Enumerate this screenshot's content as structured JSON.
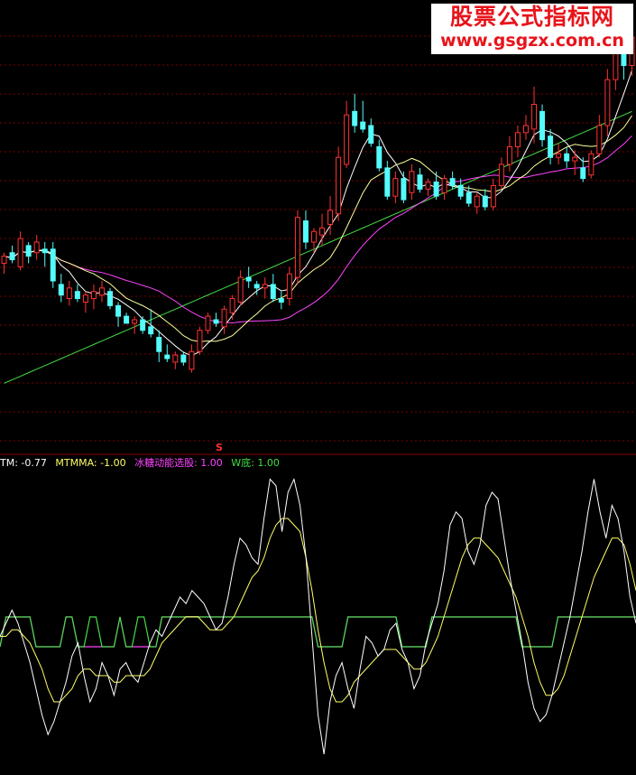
{
  "watermark": {
    "title": "股票公式指标网",
    "url": "www.gsgzx.com.cn"
  },
  "marker": {
    "symbol": "S"
  },
  "colors": {
    "background": "#000000",
    "up": "#ff3232",
    "down": "#54fcfc",
    "ma5": "#ffffff",
    "ma10": "#ffff99",
    "ma20": "#ff44ff",
    "ma60": "#44dd44",
    "grid": "#7a0000",
    "separator": "#8a0000"
  },
  "legend": [
    {
      "label": "TM",
      "value": "-0.77",
      "color": "#ffffff"
    },
    {
      "label": "MTMMA",
      "value": "-1.00",
      "color": "#ffff66"
    },
    {
      "label": "冰糖动能选股",
      "value": "1.00",
      "color": "#ff44ff"
    },
    {
      "label": "W底",
      "value": "1.00",
      "color": "#44dd44"
    }
  ],
  "chart_data": [
    {
      "type": "candlestick",
      "ylim": [
        0,
        100
      ],
      "candles": [
        [
          58,
          61,
          55,
          60
        ],
        [
          61,
          63,
          58,
          59
        ],
        [
          57,
          67,
          56,
          65
        ],
        [
          63,
          64,
          58,
          60
        ],
        [
          61,
          66,
          59,
          64
        ],
        [
          62,
          64,
          57,
          61
        ],
        [
          62,
          64,
          51,
          53
        ],
        [
          52,
          55,
          47,
          49
        ],
        [
          48,
          53,
          46,
          51
        ],
        [
          50,
          52,
          47,
          48
        ],
        [
          47,
          50,
          44,
          49
        ],
        [
          48,
          52,
          45,
          50
        ],
        [
          49,
          53,
          47,
          51
        ],
        [
          50,
          51,
          45,
          46
        ],
        [
          46,
          47,
          40,
          43
        ],
        [
          43,
          44,
          41,
          41
        ],
        [
          41,
          43,
          38,
          42
        ],
        [
          42,
          43,
          38,
          39
        ],
        [
          40,
          45,
          37,
          38
        ],
        [
          37,
          39,
          30,
          33
        ],
        [
          32,
          35,
          30,
          31
        ],
        [
          30,
          33,
          28,
          32
        ],
        [
          32,
          33,
          29,
          30
        ],
        [
          28,
          35,
          27,
          33
        ],
        [
          33,
          40,
          32,
          39
        ],
        [
          39,
          44,
          38,
          43
        ],
        [
          42,
          44,
          40,
          41
        ],
        [
          40,
          46,
          38,
          45
        ],
        [
          44,
          49,
          42,
          48
        ],
        [
          47,
          56,
          46,
          54
        ],
        [
          54,
          57,
          51,
          53
        ],
        [
          52,
          53,
          49,
          51
        ],
        [
          51,
          54,
          48,
          52
        ],
        [
          52,
          55,
          47,
          48
        ],
        [
          48,
          50,
          45,
          47
        ],
        [
          48,
          57,
          46,
          55
        ],
        [
          54,
          73,
          52,
          71
        ],
        [
          70,
          73,
          62,
          64
        ],
        [
          64,
          68,
          61,
          67
        ],
        [
          66,
          72,
          63,
          68
        ],
        [
          69,
          77,
          66,
          73
        ],
        [
          72,
          91,
          70,
          88
        ],
        [
          86,
          104,
          85,
          100
        ],
        [
          101,
          106,
          95,
          97
        ],
        [
          98,
          104,
          95,
          96
        ],
        [
          97,
          99,
          91,
          92
        ],
        [
          91,
          93,
          84,
          85
        ],
        [
          85,
          87,
          76,
          77
        ],
        [
          77,
          84,
          75,
          82
        ],
        [
          82,
          84,
          75,
          76
        ],
        [
          78,
          86,
          76,
          84
        ],
        [
          83,
          85,
          78,
          79
        ],
        [
          79,
          82,
          77,
          81
        ],
        [
          81,
          84,
          76,
          77
        ],
        [
          78,
          83,
          76,
          82
        ],
        [
          82,
          84,
          79,
          80
        ],
        [
          80,
          82,
          76,
          77
        ],
        [
          78,
          80,
          74,
          75
        ],
        [
          74,
          78,
          72,
          77
        ],
        [
          77,
          79,
          73,
          74
        ],
        [
          74,
          82,
          73,
          80
        ],
        [
          80,
          88,
          79,
          86
        ],
        [
          86,
          94,
          84,
          91
        ],
        [
          91,
          97,
          88,
          95
        ],
        [
          95,
          100,
          93,
          97
        ],
        [
          96,
          108,
          92,
          103
        ],
        [
          101,
          103,
          91,
          93
        ],
        [
          94,
          96,
          86,
          88
        ],
        [
          88,
          92,
          86,
          89
        ],
        [
          89,
          91,
          85,
          87
        ],
        [
          87,
          90,
          83,
          88
        ],
        [
          85,
          88,
          81,
          82
        ],
        [
          83,
          90,
          82,
          89
        ],
        [
          89,
          100,
          88,
          97
        ],
        [
          97,
          113,
          94,
          110
        ],
        [
          110,
          124,
          107,
          120
        ],
        [
          119,
          122,
          110,
          114
        ],
        [
          114,
          126,
          111,
          122
        ]
      ],
      "ma60": [
        24,
        25,
        26,
        27,
        28,
        29,
        30,
        31,
        32,
        33,
        34,
        35,
        36,
        37,
        38,
        39,
        40,
        41,
        42,
        43,
        44,
        45,
        46,
        47,
        48,
        49,
        50,
        51,
        52,
        53,
        54,
        55,
        56,
        57,
        58,
        59,
        60,
        61,
        62,
        63,
        64,
        65,
        66,
        67,
        68,
        69,
        70,
        71,
        72,
        73,
        74,
        75,
        76,
        77,
        78,
        79,
        80,
        81,
        82,
        83,
        84,
        85,
        86,
        87,
        88,
        89,
        90,
        91,
        92,
        93,
        94,
        95,
        96,
        97,
        98,
        99,
        100,
        101
      ]
    },
    {
      "type": "line",
      "ylim": [
        -20,
        20
      ],
      "series": [
        {
          "name": "TM",
          "values": [
            -2,
            0,
            2,
            0,
            -3,
            -6,
            -10,
            -14,
            -17,
            -15,
            -12,
            -9,
            -5,
            -3,
            -8,
            -12,
            -10,
            -6,
            -8,
            -11,
            -7,
            -6,
            -8,
            -9,
            -6,
            -3,
            -1,
            -2,
            0,
            2,
            4,
            3,
            5,
            4,
            3,
            1,
            -1,
            0,
            4,
            9,
            13,
            12,
            10,
            9,
            16,
            22,
            21,
            14,
            20,
            22,
            18,
            10,
            -2,
            -14,
            -20,
            -12,
            -8,
            -6,
            -10,
            -13,
            -7,
            -2,
            -3,
            -5,
            -4,
            -1,
            0,
            -4,
            -6,
            -10,
            -8,
            -3,
            0,
            3,
            8,
            15,
            17,
            16,
            11,
            9,
            12,
            18,
            20,
            19,
            13,
            7,
            2,
            -3,
            -9,
            -13,
            -15,
            -14,
            -11,
            -7,
            -3,
            1,
            6,
            11,
            17,
            22,
            17,
            13,
            18,
            16,
            11,
            4,
            0
          ]
        },
        {
          "name": "MTMMA",
          "values": [
            -2,
            -2,
            -1,
            -1,
            -2,
            -3,
            -5,
            -7,
            -10,
            -12,
            -12,
            -11,
            -10,
            -8,
            -7,
            -7,
            -8,
            -8,
            -8,
            -9,
            -9,
            -8,
            -8,
            -8,
            -8,
            -7,
            -5,
            -3,
            -2,
            -1,
            0,
            1,
            1,
            1,
            0,
            -1,
            -1,
            -1,
            0,
            1,
            3,
            5,
            7,
            8,
            10,
            13,
            15,
            16,
            16,
            15,
            14,
            10,
            5,
            -1,
            -6,
            -10,
            -12,
            -12,
            -11,
            -9,
            -8,
            -7,
            -6,
            -5,
            -4,
            -4,
            -4,
            -5,
            -6,
            -7,
            -7,
            -6,
            -4,
            -2,
            1,
            4,
            7,
            10,
            12,
            13,
            13,
            12,
            11,
            10,
            8,
            6,
            4,
            1,
            -2,
            -6,
            -9,
            -11,
            -11,
            -10,
            -8,
            -5,
            -2,
            1,
            4,
            7,
            9,
            11,
            13,
            13,
            12,
            9,
            5
          ]
        },
        {
          "name": "冰糖动能选股",
          "values": [
            0,
            1,
            1,
            1,
            1,
            1,
            0,
            0,
            0,
            0,
            0,
            1,
            1,
            0,
            0,
            0,
            0,
            0,
            0,
            0,
            1,
            0,
            0,
            0,
            0,
            0,
            0,
            1,
            1,
            1,
            1,
            1,
            1,
            1,
            1,
            1,
            1,
            1,
            1,
            1,
            1,
            1,
            1,
            1,
            1,
            1,
            1,
            1,
            1,
            1,
            1,
            1,
            1,
            0,
            0,
            0,
            0,
            0,
            1,
            1,
            1,
            1,
            1,
            1,
            1,
            1,
            1,
            0,
            0,
            0,
            0,
            0,
            1,
            1,
            1,
            1,
            1,
            1,
            1,
            1,
            1,
            1,
            1,
            1,
            1,
            1,
            1,
            0,
            0,
            0,
            0,
            0,
            0,
            1,
            1,
            1,
            1,
            1,
            1,
            1,
            1,
            1,
            1,
            1,
            1,
            1,
            1
          ]
        },
        {
          "name": "W底",
          "values": [
            0,
            1,
            1,
            1,
            1,
            1,
            0,
            0,
            0,
            0,
            0,
            1,
            1,
            0,
            0,
            1,
            1,
            0,
            0,
            0,
            1,
            0,
            0,
            1,
            1,
            0,
            0,
            1,
            1,
            1,
            1,
            1,
            1,
            1,
            1,
            1,
            1,
            1,
            1,
            1,
            1,
            1,
            1,
            1,
            1,
            1,
            1,
            1,
            1,
            1,
            1,
            1,
            1,
            0,
            0,
            0,
            0,
            0,
            1,
            1,
            1,
            1,
            1,
            1,
            1,
            1,
            1,
            0,
            0,
            0,
            0,
            0,
            1,
            1,
            1,
            1,
            1,
            1,
            1,
            1,
            1,
            1,
            1,
            1,
            1,
            1,
            1,
            0,
            0,
            0,
            0,
            0,
            0,
            1,
            1,
            1,
            1,
            1,
            1,
            1,
            1,
            1,
            1,
            1,
            1,
            1,
            1
          ]
        }
      ]
    }
  ]
}
